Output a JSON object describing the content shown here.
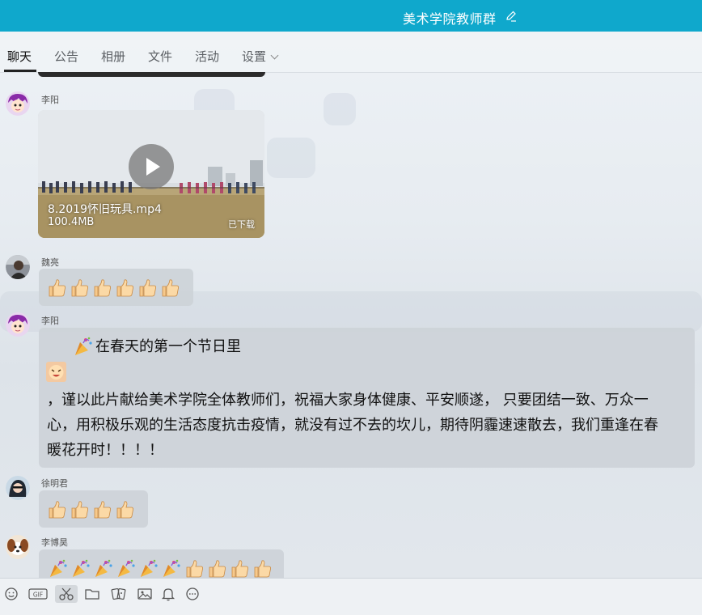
{
  "window": {
    "title": "美术学院教师群"
  },
  "tabs": [
    {
      "label": "聊天",
      "active": true
    },
    {
      "label": "公告"
    },
    {
      "label": "相册"
    },
    {
      "label": "文件"
    },
    {
      "label": "活动"
    },
    {
      "label": "设置"
    }
  ],
  "messages": [
    {
      "sender": "李阳",
      "video": {
        "filename": "8.2019怀旧玩具.mp4",
        "size": "100.4MB",
        "status": "已下载"
      }
    },
    {
      "sender": "魏亮",
      "emoji": [
        "thumbs-up",
        "thumbs-up",
        "thumbs-up",
        "thumbs-up",
        "thumbs-up",
        "thumbs-up"
      ]
    },
    {
      "sender": "李阳",
      "line1": "在春天的第一个节日里",
      "line2": "，谨以此片献给美术学院全体教师们，祝福大家身体健康、平安顺遂， 只要团结一致、万众一",
      "line3": "心，用积极乐观的生活态度抗击疫情，就没有过不去的坎儿，期待阴霾速速散去，我们重逢在春",
      "line4": "暖花开时！！！！"
    },
    {
      "sender": "徐明君",
      "emoji": [
        "thumbs-up",
        "thumbs-up",
        "thumbs-up",
        "thumbs-up"
      ]
    },
    {
      "sender": "李博昊",
      "emoji": [
        "party-popper",
        "party-popper",
        "party-popper",
        "party-popper",
        "party-popper",
        "party-popper",
        "thumbs-up",
        "thumbs-up",
        "thumbs-up",
        "thumbs-up"
      ]
    }
  ],
  "toolbar": [
    "emoji-icon",
    "gif-icon",
    "scissors-icon",
    "folder-icon",
    "magic-face-icon",
    "image-icon",
    "bell-icon",
    "more-icon"
  ],
  "colors": {
    "titlebar": "#0fa8cc",
    "bubble": "#cdd2d8"
  }
}
